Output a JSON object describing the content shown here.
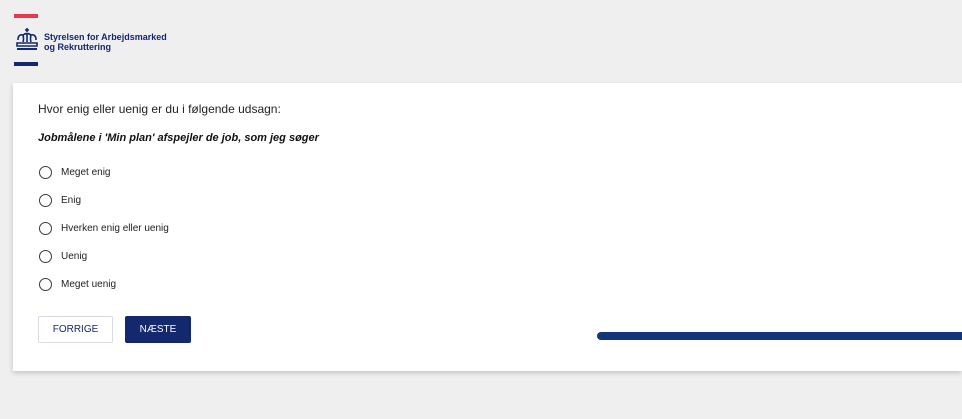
{
  "header": {
    "org_line1": "Styrelsen for Arbejdsmarked",
    "org_line2": "og Rekruttering",
    "logo_icon": "crown-icon"
  },
  "survey": {
    "question": "Hvor enig eller uenig er du i følgende udsagn:",
    "statement": "Jobmålene i 'Min plan' afspejler de job, som jeg søger",
    "options": [
      "Meget enig",
      "Enig",
      "Hverken enig eller uenig",
      "Uenig",
      "Meget uenig"
    ],
    "selected_option": null
  },
  "nav": {
    "prev_label": "FORRIGE",
    "next_label": "NÆSTE"
  },
  "colors": {
    "brand_blue": "#14286e",
    "brand_red": "#e8394a",
    "progress": "#13357a"
  }
}
